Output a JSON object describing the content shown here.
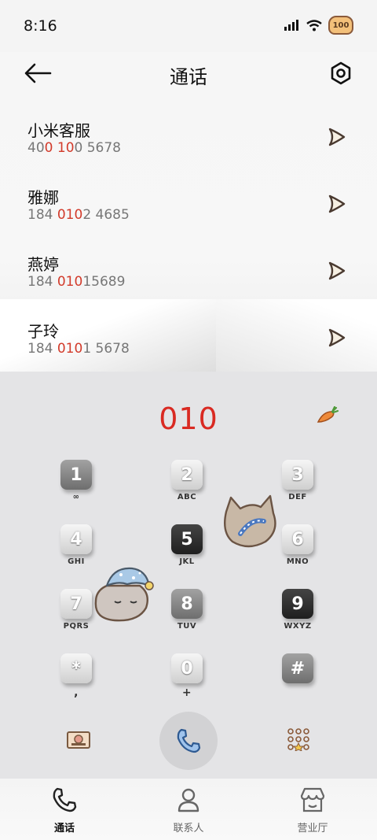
{
  "status": {
    "time": "8:16",
    "battery": "100"
  },
  "header": {
    "title": "通话"
  },
  "contacts": [
    {
      "name": "小米客服",
      "num_parts": [
        "40",
        "0",
        " ",
        "10",
        "0 5678"
      ]
    },
    {
      "name": "雅娜",
      "num_parts": [
        "184 ",
        "010",
        "2 4685",
        "",
        ""
      ]
    },
    {
      "name": "燕婷",
      "num_parts": [
        "184 ",
        "010",
        "15689",
        "",
        ""
      ]
    },
    {
      "name": "子玲",
      "num_parts": [
        "184 ",
        "010",
        "1 5678",
        "",
        ""
      ]
    }
  ],
  "dialer": {
    "input": "010",
    "keys": [
      {
        "digit": "1",
        "sub": "∞"
      },
      {
        "digit": "2",
        "sub": "ABC"
      },
      {
        "digit": "3",
        "sub": "DEF"
      },
      {
        "digit": "4",
        "sub": "GHI"
      },
      {
        "digit": "5",
        "sub": "JKL"
      },
      {
        "digit": "6",
        "sub": "MNO"
      },
      {
        "digit": "7",
        "sub": "PQRS"
      },
      {
        "digit": "8",
        "sub": "TUV"
      },
      {
        "digit": "9",
        "sub": "WXYZ"
      },
      {
        "digit": "*",
        "sub": ","
      },
      {
        "digit": "0",
        "sub": "+"
      },
      {
        "digit": "#",
        "sub": ""
      }
    ]
  },
  "tabs": [
    {
      "label": "通话",
      "icon": "phone-icon",
      "active": true
    },
    {
      "label": "联系人",
      "icon": "person-icon",
      "active": false
    },
    {
      "label": "营业厅",
      "icon": "store-icon",
      "active": false
    }
  ],
  "colors": {
    "accent_red": "#d92a22",
    "call_blue": "#4d84c6"
  }
}
